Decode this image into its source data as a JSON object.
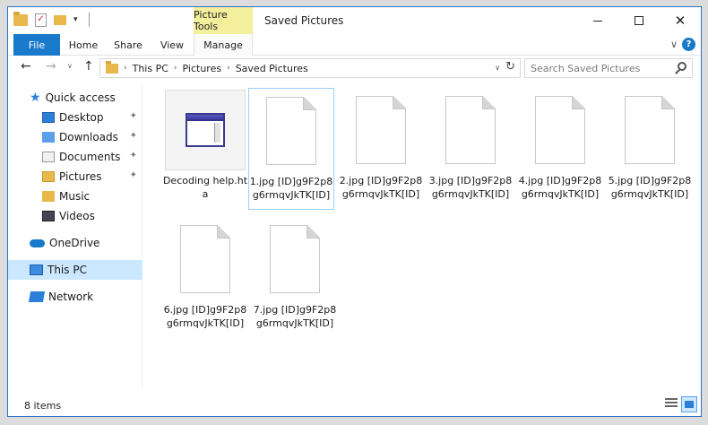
{
  "window": {
    "title": "Saved Pictures",
    "context_tab_label": "Picture Tools",
    "minimize_glyph": "",
    "maximize_glyph": "",
    "close_glyph": "✕"
  },
  "ribbon": {
    "tabs": [
      "File",
      "Home",
      "Share",
      "View",
      "Manage"
    ],
    "expand_glyph": "∨",
    "help_glyph": "?"
  },
  "nav": {
    "back_glyph": "←",
    "forward_glyph": "→",
    "recent_glyph": "∨",
    "up_glyph": "↑",
    "breadcrumb": [
      "This PC",
      "Pictures",
      "Saved Pictures"
    ],
    "crumb_sep": "›",
    "address_dropdown": "∨",
    "refresh_glyph": "↻",
    "search_placeholder": "Search Saved Pictures"
  },
  "navpane": {
    "items": [
      {
        "label": "Quick access",
        "icon": "star-icon"
      },
      {
        "label": "Desktop",
        "icon": "desktop-icon",
        "pinned": true
      },
      {
        "label": "Downloads",
        "icon": "downloads-icon",
        "pinned": true
      },
      {
        "label": "Documents",
        "icon": "documents-icon",
        "pinned": true
      },
      {
        "label": "Pictures",
        "icon": "pictures-icon",
        "pinned": true
      },
      {
        "label": "Music",
        "icon": "music-icon"
      },
      {
        "label": "Videos",
        "icon": "videos-icon"
      },
      {
        "label": "OneDrive",
        "icon": "onedrive-icon"
      },
      {
        "label": "This PC",
        "icon": "pc-icon",
        "selected": true
      },
      {
        "label": "Network",
        "icon": "network-icon"
      }
    ],
    "pin_glyph": "✦"
  },
  "files": [
    {
      "name": "Decoding help.hta",
      "type": "hta"
    },
    {
      "name": "1.jpg [ID]g9F2p8g6rmqvJkTK[ID]",
      "type": "file",
      "selected": true
    },
    {
      "name": "2.jpg [ID]g9F2p8g6rmqvJkTK[ID]",
      "type": "file"
    },
    {
      "name": "3.jpg [ID]g9F2p8g6rmqvJkTK[ID]",
      "type": "file"
    },
    {
      "name": "4.jpg [ID]g9F2p8g6rmqvJkTK[ID]",
      "type": "file"
    },
    {
      "name": "5.jpg [ID]g9F2p8g6rmqvJkTK[ID]",
      "type": "file"
    },
    {
      "name": "6.jpg [ID]g9F2p8g6rmqvJkTK[ID]",
      "type": "file"
    },
    {
      "name": "7.jpg [ID]g9F2p8g6rmqvJkTK[ID]",
      "type": "file"
    }
  ],
  "status": {
    "item_count": "8 items"
  },
  "colors": {
    "accent": "#1979ca",
    "picture_tools": "#f4ef9c",
    "selection": "#cce8ff"
  }
}
